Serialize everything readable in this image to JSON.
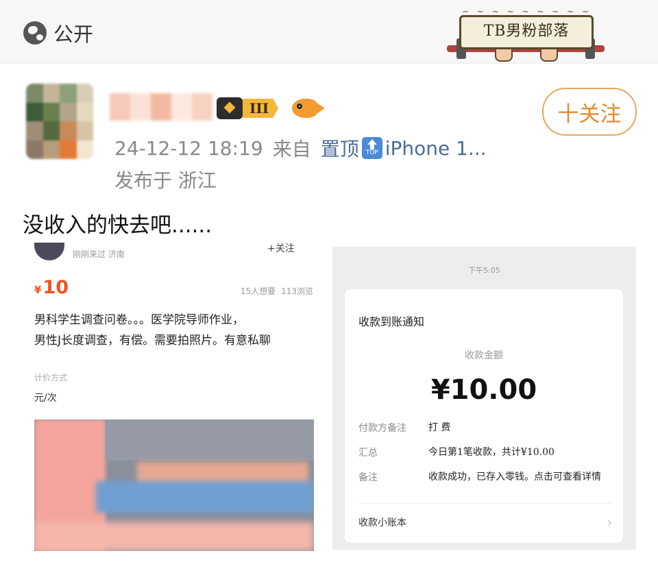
{
  "header": {
    "visibility_label": "公开",
    "watermark_text": "TB男粉部落"
  },
  "post": {
    "rank_badge": "III",
    "follow_label": "十关注",
    "timestamp": "24-12-12 18:19",
    "from_label": "来自",
    "pinned_label": "置顶",
    "top_icon_text": "TOP",
    "device": "iPhone 1...",
    "location": "发布于 浙江",
    "text": "没收入的快去吧......",
    "colors": {
      "follow_accent": "#e58a2a",
      "meta_link": "#4a6b9a"
    }
  },
  "left_screenshot": {
    "last_seen": "刚刚来过 济南",
    "follow": "+关注",
    "price_symbol": "¥",
    "price": "10",
    "wants": "15人想要",
    "views": "113浏览",
    "desc_line1": "男科学生调查问卷。。。医学院导师作业，",
    "desc_line2": "男性J长度调查，有偿。需要拍照片。有意私聊",
    "pricing_label": "计价方式",
    "unit": "元/次"
  },
  "right_screenshot": {
    "time": "下午5:05",
    "title": "收款到账通知",
    "amount_label": "收款金额",
    "amount": "¥10.00",
    "payer_note_label": "付款方备注",
    "payer_note": "打 费",
    "summary_label": "汇总",
    "summary": "今日第1笔收款，共计¥10.00",
    "remark_label": "备注",
    "remark": "收款成功，已存入零钱。点击可查看详情",
    "footer_link": "收款小账本"
  }
}
